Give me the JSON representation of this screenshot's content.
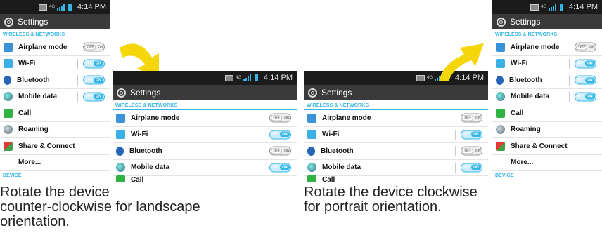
{
  "status_bar": {
    "time": "4:14 PM",
    "network": "4G"
  },
  "app": {
    "title": "Settings"
  },
  "sections": {
    "wireless": "WIRELESS & NETWORKS",
    "device": "DEVICE"
  },
  "rows": [
    {
      "label": "Airplane mode",
      "icon": "airplane-icon",
      "toggle": "off"
    },
    {
      "label": "Wi-Fi",
      "icon": "wifi-icon",
      "toggle": "on"
    },
    {
      "label": "Bluetooth",
      "icon": "bluetooth-icon",
      "toggle": "on"
    },
    {
      "label": "Mobile data",
      "icon": "mobile-data-icon",
      "toggle": "on"
    },
    {
      "label": "Call",
      "icon": "call-icon"
    },
    {
      "label": "Roaming",
      "icon": "roaming-icon"
    },
    {
      "label": "Share & Connect",
      "icon": "share-connect-icon"
    },
    {
      "label": "More...",
      "icon": ""
    }
  ],
  "landscape_rows_bluetooth_toggle": "off",
  "toggle_labels": {
    "off": "OFF",
    "on": "ON"
  },
  "captions": {
    "left": [
      "Rotate the device",
      "counter-clockwise for landscape",
      "orientation."
    ],
    "right": [
      "Rotate the device clockwise",
      "for portrait orientation."
    ]
  },
  "colors": {
    "accent": "#33b5e5",
    "arrow": "#f5d60a",
    "titlebar": "#3a3a3a",
    "statusbar": "#1b1b1b"
  }
}
